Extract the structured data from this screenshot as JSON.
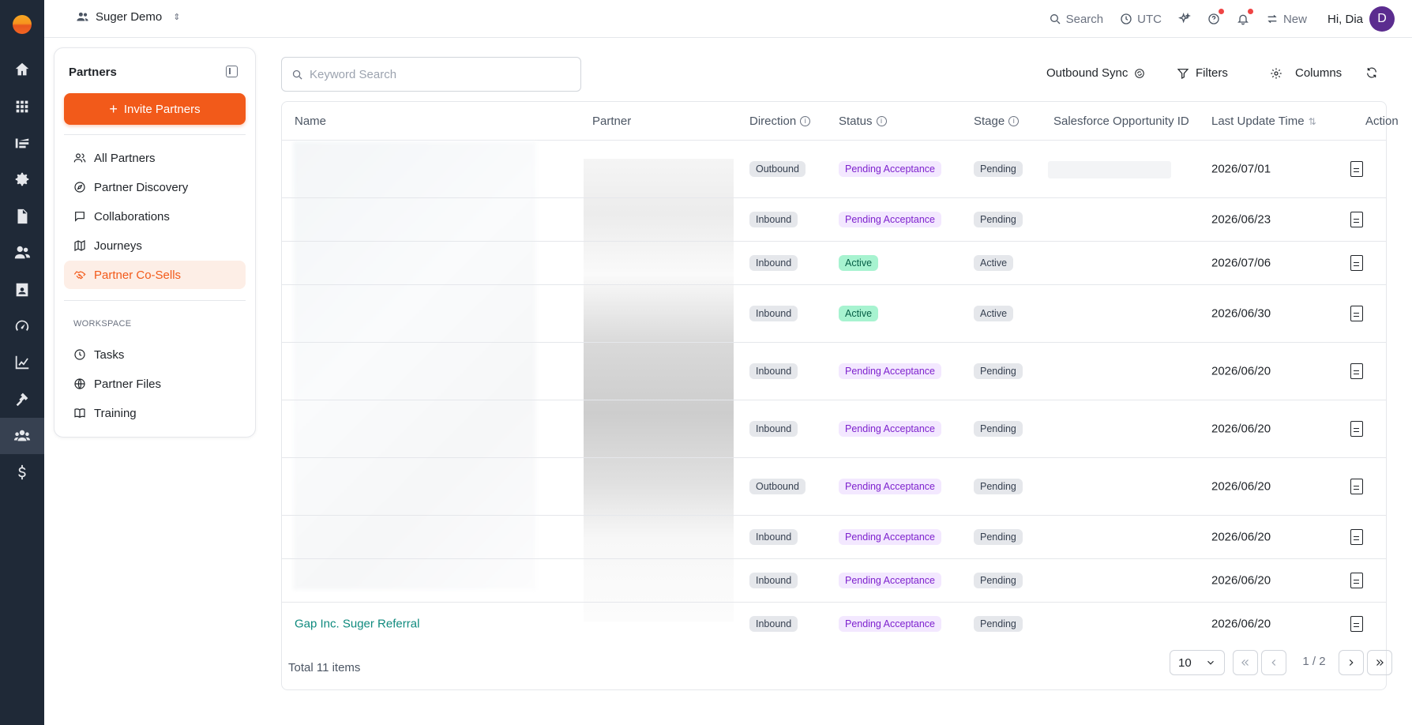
{
  "header": {
    "workspace": "Suger Demo",
    "search": "Search",
    "timezone": "UTC",
    "new": "New",
    "greeting": "Hi, Dia",
    "avatar_initial": "D"
  },
  "sidebar": {
    "title": "Partners",
    "invite_button": "Invite Partners",
    "items": [
      {
        "label": "All Partners",
        "icon": "users-icon"
      },
      {
        "label": "Partner Discovery",
        "icon": "compass-icon"
      },
      {
        "label": "Collaborations",
        "icon": "message-icon"
      },
      {
        "label": "Journeys",
        "icon": "map-icon"
      },
      {
        "label": "Partner Co-Sells",
        "icon": "handshake-icon",
        "active": true
      }
    ],
    "workspace_label": "WORKSPACE",
    "workspace_items": [
      {
        "label": "Tasks",
        "icon": "clock-icon"
      },
      {
        "label": "Partner Files",
        "icon": "globe-icon"
      },
      {
        "label": "Training",
        "icon": "book-icon"
      }
    ]
  },
  "toolbar": {
    "search_placeholder": "Keyword Search",
    "outbound_sync": "Outbound Sync",
    "filters": "Filters",
    "columns": "Columns"
  },
  "table": {
    "columns": [
      "Name",
      "Partner",
      "Direction",
      "Status",
      "Stage",
      "Salesforce Opportunity ID",
      "Last Update Time",
      "Action"
    ],
    "rows": [
      {
        "name": "",
        "direction": "Outbound",
        "status": "Pending Acceptance",
        "stage": "Pending",
        "updated": "2026/07/01"
      },
      {
        "name": "",
        "direction": "Inbound",
        "status": "Pending Acceptance",
        "stage": "Pending",
        "updated": "2026/06/23"
      },
      {
        "name": "",
        "direction": "Inbound",
        "status": "Active",
        "stage": "Active",
        "updated": "2026/07/06"
      },
      {
        "name": "",
        "direction": "Inbound",
        "status": "Active",
        "stage": "Active",
        "updated": "2026/06/30"
      },
      {
        "name": "",
        "direction": "Inbound",
        "status": "Pending Acceptance",
        "stage": "Pending",
        "updated": "2026/06/20"
      },
      {
        "name": "",
        "direction": "Inbound",
        "status": "Pending Acceptance",
        "stage": "Pending",
        "updated": "2026/06/20"
      },
      {
        "name": "",
        "direction": "Outbound",
        "status": "Pending Acceptance",
        "stage": "Pending",
        "updated": "2026/06/20"
      },
      {
        "name": "",
        "direction": "Inbound",
        "status": "Pending Acceptance",
        "stage": "Pending",
        "updated": "2026/06/20"
      },
      {
        "name": "",
        "direction": "Inbound",
        "status": "Pending Acceptance",
        "stage": "Pending",
        "updated": "2026/06/20"
      },
      {
        "name": "Gap Inc. Suger Referral",
        "direction": "Inbound",
        "status": "Pending Acceptance",
        "stage": "Pending",
        "updated": "2026/06/20"
      }
    ],
    "total": "Total 11 items",
    "page_size": "10",
    "page_indicator": "1 / 2"
  },
  "colors": {
    "accent": "#f25a1a",
    "rail": "#1f2937",
    "status_pending": "#7e22ce",
    "status_active": "#065f46",
    "link": "#0f8a7e"
  }
}
